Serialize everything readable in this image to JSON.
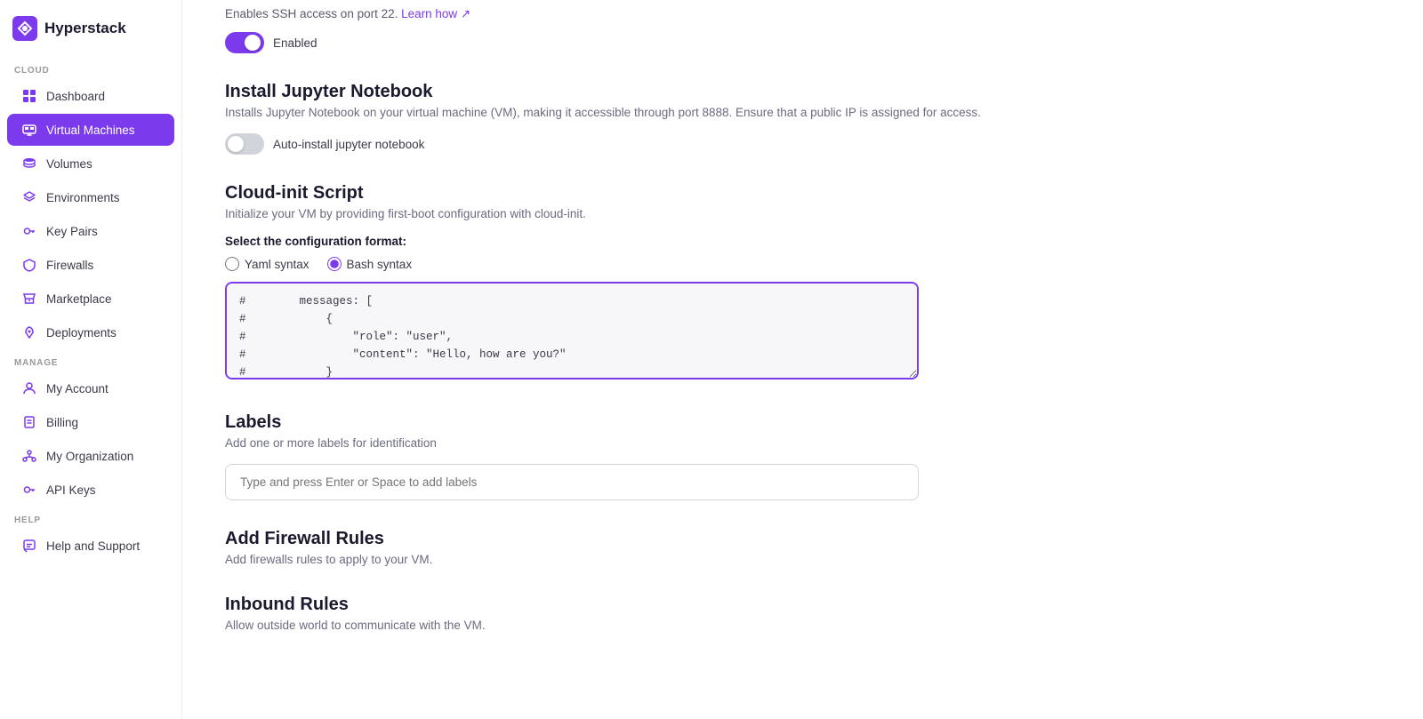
{
  "app": {
    "name": "Hyperstack"
  },
  "sidebar": {
    "section_cloud": "CLOUD",
    "section_manage": "MANAGE",
    "section_help": "HELP",
    "items_cloud": [
      {
        "id": "dashboard",
        "label": "Dashboard",
        "icon": "grid"
      },
      {
        "id": "virtual-machines",
        "label": "Virtual Machines",
        "icon": "vm",
        "active": true
      },
      {
        "id": "volumes",
        "label": "Volumes",
        "icon": "stack"
      },
      {
        "id": "environments",
        "label": "Environments",
        "icon": "layers"
      },
      {
        "id": "key-pairs",
        "label": "Key Pairs",
        "icon": "key"
      },
      {
        "id": "firewalls",
        "label": "Firewalls",
        "icon": "shield"
      },
      {
        "id": "marketplace",
        "label": "Marketplace",
        "icon": "store"
      },
      {
        "id": "deployments",
        "label": "Deployments",
        "icon": "rocket"
      }
    ],
    "items_manage": [
      {
        "id": "my-account",
        "label": "My Account",
        "icon": "user"
      },
      {
        "id": "billing",
        "label": "Billing",
        "icon": "file"
      },
      {
        "id": "my-organization",
        "label": "My Organization",
        "icon": "org"
      },
      {
        "id": "api-keys",
        "label": "API Keys",
        "icon": "key2"
      }
    ],
    "items_help": [
      {
        "id": "help-support",
        "label": "Help and Support",
        "icon": "help"
      }
    ]
  },
  "main": {
    "ssh_note": "Enables SSH access on port 22.",
    "learn_link_text": "Learn how ↗",
    "ssh_toggle_label": "Enabled",
    "ssh_enabled": true,
    "jupyter_title": "Install Jupyter Notebook",
    "jupyter_desc": "Installs Jupyter Notebook on your virtual machine (VM), making it accessible through port 8888. Ensure that a public IP is assigned for access.",
    "jupyter_toggle_label": "Auto-install jupyter notebook",
    "jupyter_enabled": false,
    "cloudinit_title": "Cloud-init Script",
    "cloudinit_desc": "Initialize your VM by providing first-boot configuration with cloud-init.",
    "config_format_label": "Select the configuration format:",
    "yaml_option": "Yaml syntax",
    "bash_option": "Bash syntax",
    "bash_selected": true,
    "code_content": "#        messages: [\n#            {\n#                \"role\": \"user\",\n#                \"content\": \"Hello, how are you?\"\n#            }\n#        ]\n#    ]\n#}",
    "labels_title": "Labels",
    "labels_desc": "Add one or more labels for identification",
    "labels_placeholder": "Type and press Enter or Space to add labels",
    "firewall_title": "Add Firewall Rules",
    "firewall_desc": "Add firewalls rules to apply to your VM.",
    "inbound_title": "Inbound Rules",
    "inbound_desc": "Allow outside world to communicate with the VM."
  }
}
